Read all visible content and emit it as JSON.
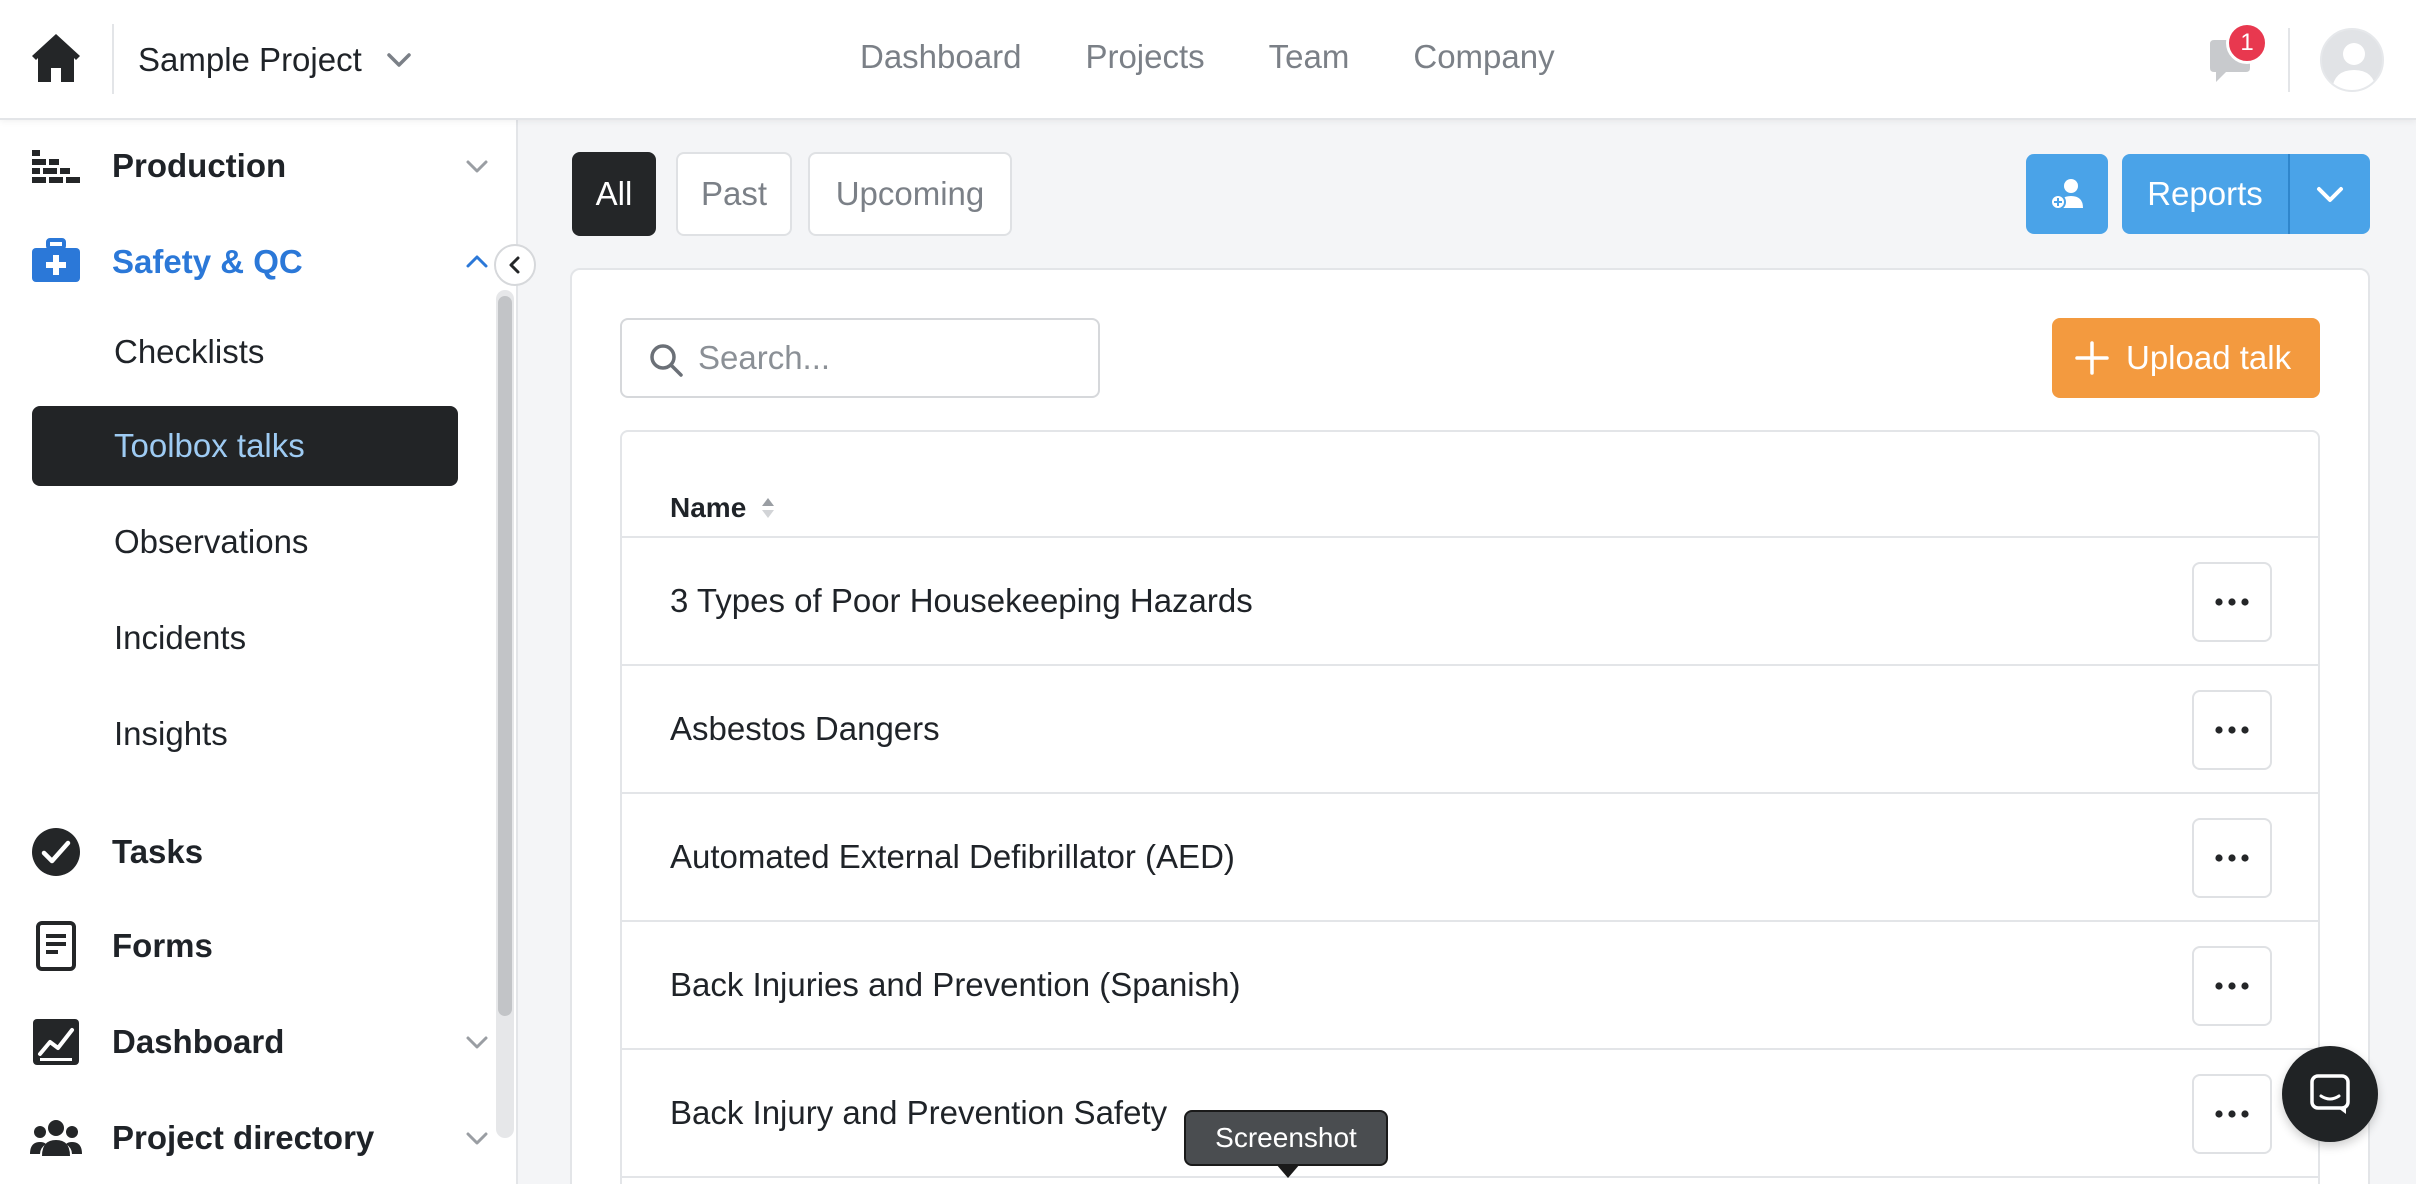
{
  "topbar": {
    "project_name": "Sample Project",
    "nav": [
      "Dashboard",
      "Projects",
      "Team",
      "Company"
    ],
    "notification_count": "1"
  },
  "sidebar": {
    "production": "Production",
    "safety_qc": "Safety & QC",
    "sub_items": [
      "Checklists",
      "Toolbox talks",
      "Observations",
      "Incidents",
      "Insights"
    ],
    "active_sub_item": "Toolbox talks",
    "tasks": "Tasks",
    "forms": "Forms",
    "dashboard": "Dashboard",
    "project_directory": "Project directory"
  },
  "filters": {
    "all": "All",
    "past": "Past",
    "upcoming": "Upcoming",
    "active": "All"
  },
  "actions": {
    "reports_label": "Reports"
  },
  "search": {
    "placeholder": "Search...",
    "value": ""
  },
  "upload": {
    "label": "Upload talk"
  },
  "table": {
    "name_header": "Name",
    "rows": [
      "3 Types of Poor Housekeeping Hazards",
      "Asbestos Dangers",
      "Automated External Defibrillator (AED)",
      "Back Injuries and Prevention (Spanish)",
      "Back Injury and Prevention Safety"
    ]
  },
  "tooltip": "Screenshot",
  "colors": {
    "accent_blue": "#4aa3e8",
    "active_link_blue": "#2b78d8",
    "upload_orange": "#f39a3f",
    "badge_red": "#e8384f",
    "dark": "#242628"
  }
}
